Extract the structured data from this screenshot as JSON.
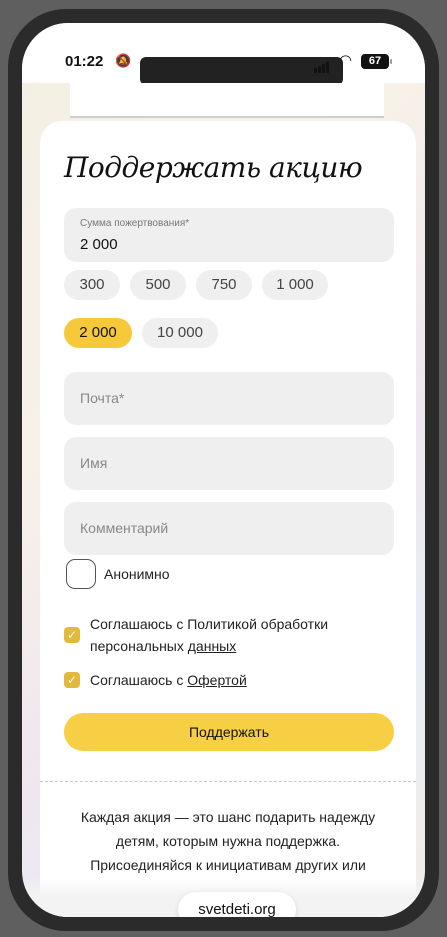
{
  "status_bar": {
    "time": "01:22",
    "mute_icon": "bell-slash-icon",
    "battery": "67"
  },
  "form": {
    "title": "Поддержать акцию",
    "amount": {
      "label": "Сумма пожертвования*",
      "value": "2 000"
    },
    "presets": [
      "300",
      "500",
      "750",
      "1 000",
      "2 000",
      "10 000"
    ],
    "selected_preset": "2 000",
    "fields": {
      "email_placeholder": "Почта*",
      "name_placeholder": "Имя",
      "comment_placeholder": "Комментарий"
    },
    "anonymous_label": "Анонимно",
    "consents": {
      "privacy_text": "Соглашаюсь с Политикой обработки персональных",
      "privacy_link": "данных",
      "offer_text": "Соглашаюсь с",
      "offer_link": "Офертой"
    },
    "submit_label": "Поддержать"
  },
  "promo_text": "Каждая акция — это шанс подарить надежду детям, которым нужна поддержка. Присоединяйся к инициативам других или",
  "browser": {
    "url": "svetdeti.org"
  },
  "colors": {
    "accent": "#f6cf45",
    "checkbox": "#e2b93b"
  }
}
